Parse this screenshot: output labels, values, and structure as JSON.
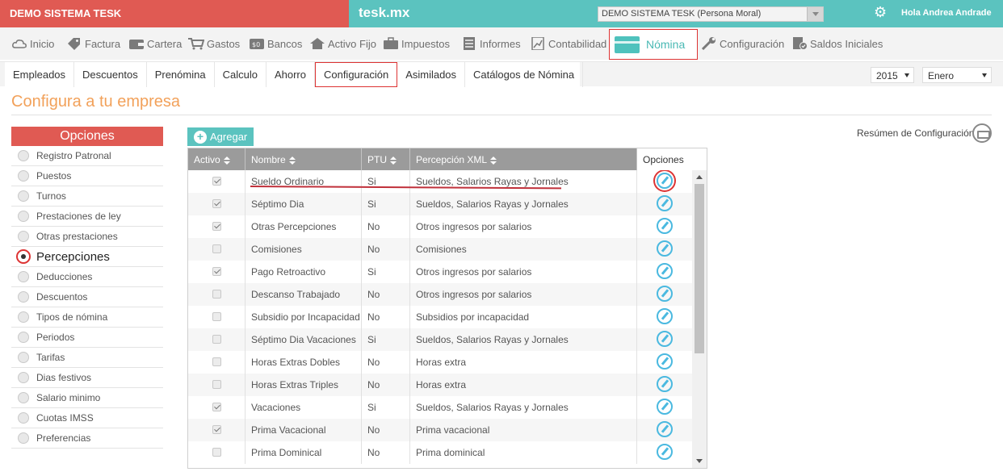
{
  "top": {
    "brand": "DEMO SISTEMA TESK",
    "app_title": "tesk.mx",
    "company_select": "DEMO SISTEMA TESK (Persona Moral)",
    "greeting": "Hola Andrea Andrade"
  },
  "nav": {
    "items": [
      "Inicio",
      "Factura",
      "Cartera",
      "Gastos",
      "Bancos",
      "Activo Fijo",
      "Impuestos",
      "Informes",
      "Contabilidad",
      "Nómina",
      "Configuración",
      "Saldos Iniciales"
    ],
    "icons": [
      "cloud-icon",
      "tag-icon",
      "wallet-icon",
      "cart-icon",
      "bank-icon",
      "house-icon",
      "briefcase-icon",
      "list-icon",
      "chart-doc-icon",
      "card-icon",
      "wrench-icon",
      "doc-check-icon"
    ],
    "active": "Nómina"
  },
  "subnav": {
    "items": [
      "Empleados",
      "Descuentos",
      "Prenómina",
      "Calculo",
      "Ahorro",
      "Configuración",
      "Asimilados",
      "Catálogos de Nómina"
    ],
    "active": "Configuración",
    "year": "2015",
    "month": "Enero"
  },
  "page": {
    "title": "Configura a tu empresa",
    "add_label": "Agregar",
    "resumen": "Resúmen de Configuración"
  },
  "sidebar": {
    "header": "Opciones",
    "items": [
      "Registro Patronal",
      "Puestos",
      "Turnos",
      "Prestaciones de ley",
      "Otras prestaciones",
      "Percepciones",
      "Deducciones",
      "Descuentos",
      "Tipos de nómina",
      "Periodos",
      "Tarifas",
      "Dias festivos",
      "Salario minimo",
      "Cuotas IMSS",
      "Preferencias"
    ],
    "selected": "Percepciones"
  },
  "table": {
    "headers": [
      "Activo",
      "Nombre",
      "PTU",
      "Percepción XML",
      "Opciones"
    ],
    "rows": [
      {
        "activo": true,
        "nombre": "Sueldo Ordinario",
        "ptu": "Si",
        "xml": "Sueldos, Salarios Rayas y Jornales"
      },
      {
        "activo": true,
        "nombre": "Séptimo Dia",
        "ptu": "Si",
        "xml": "Sueldos, Salarios Rayas y Jornales"
      },
      {
        "activo": true,
        "nombre": "Otras Percepciones",
        "ptu": "No",
        "xml": "Otros ingresos por salarios"
      },
      {
        "activo": false,
        "nombre": "Comisiones",
        "ptu": "No",
        "xml": "Comisiones"
      },
      {
        "activo": true,
        "nombre": "Pago Retroactivo",
        "ptu": "Si",
        "xml": "Otros ingresos por salarios"
      },
      {
        "activo": false,
        "nombre": "Descanso Trabajado",
        "ptu": "No",
        "xml": "Otros ingresos por salarios"
      },
      {
        "activo": false,
        "nombre": "Subsidio por Incapacidad",
        "ptu": "No",
        "xml": "Subsidios por incapacidad"
      },
      {
        "activo": false,
        "nombre": "Séptimo Dia Vacaciones",
        "ptu": "Si",
        "xml": "Sueldos, Salarios Rayas y Jornales"
      },
      {
        "activo": false,
        "nombre": "Horas Extras Dobles",
        "ptu": "No",
        "xml": "Horas extra"
      },
      {
        "activo": false,
        "nombre": "Horas Extras Triples",
        "ptu": "No",
        "xml": "Horas extra"
      },
      {
        "activo": true,
        "nombre": "Vacaciones",
        "ptu": "Si",
        "xml": "Sueldos, Salarios Rayas y Jornales"
      },
      {
        "activo": true,
        "nombre": "Prima Vacacional",
        "ptu": "No",
        "xml": "Prima vacacional"
      },
      {
        "activo": false,
        "nombre": "Prima Dominical",
        "ptu": "No",
        "xml": "Prima dominical"
      }
    ]
  },
  "colors": {
    "brand_red": "#e05a53",
    "teal": "#5bc3bf",
    "title_orange": "#f2a15a",
    "highlight_red": "#dd3333"
  }
}
